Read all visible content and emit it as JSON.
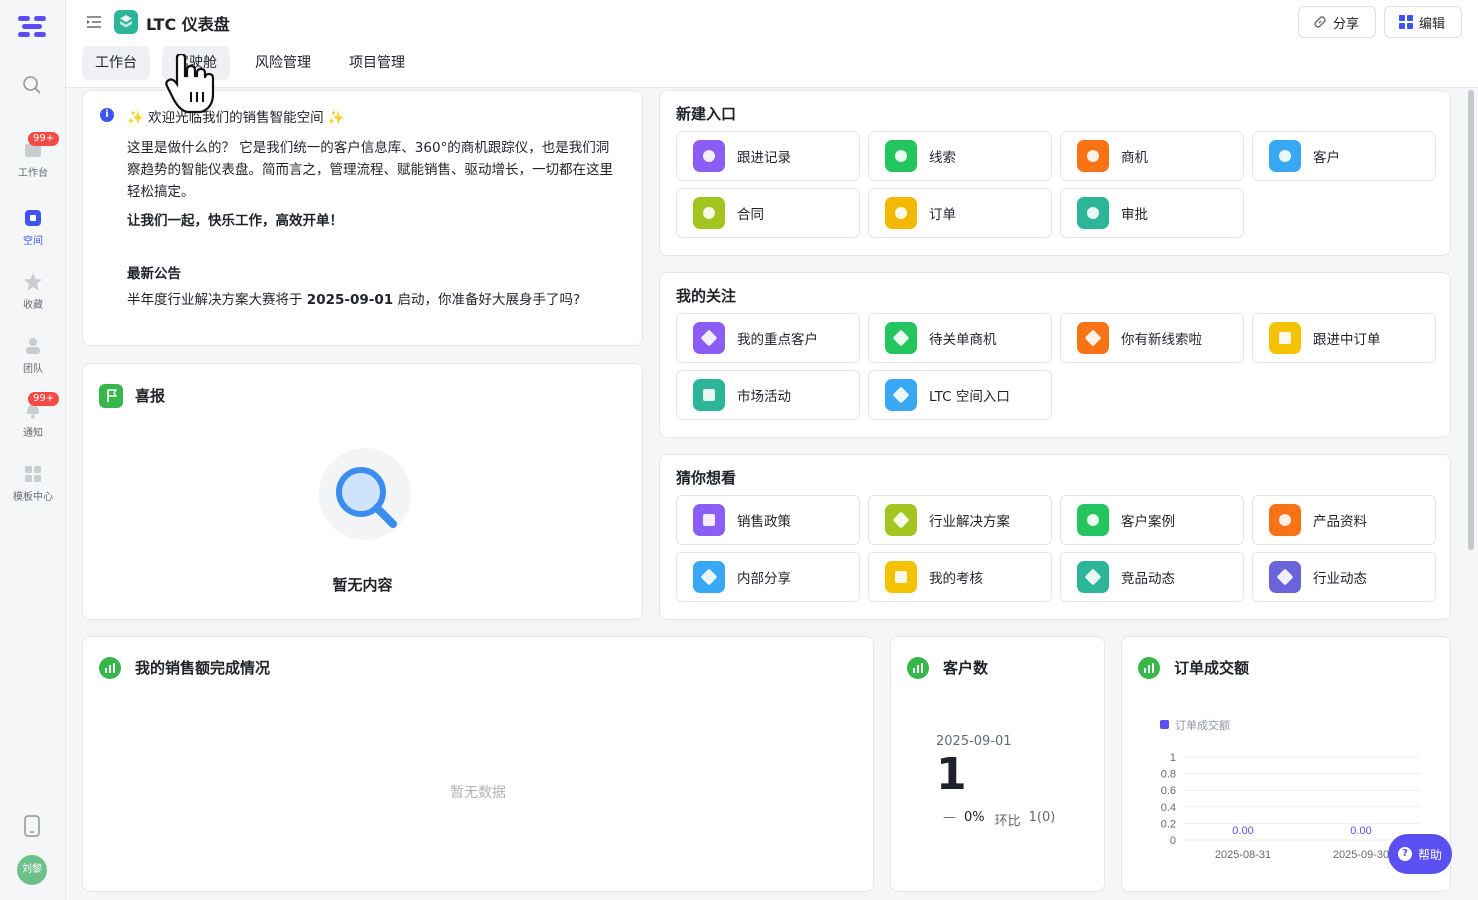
{
  "app": {
    "title": "LTC 仪表盘",
    "share_label": "分享",
    "edit_label": "编辑"
  },
  "tabs": [
    {
      "label": "工作台",
      "active": true
    },
    {
      "label": "驾驶舱",
      "active": false
    },
    {
      "label": "风险管理",
      "active": false
    },
    {
      "label": "项目管理",
      "active": false
    }
  ],
  "sidebar": {
    "items": [
      {
        "label": "工作台",
        "icon": "workspace-icon",
        "badge": "99+"
      },
      {
        "label": "空间",
        "icon": "space-icon",
        "active": true
      },
      {
        "label": "收藏",
        "icon": "star-icon"
      },
      {
        "label": "团队",
        "icon": "team-icon"
      },
      {
        "label": "通知",
        "icon": "bell-icon",
        "badge": "99+"
      },
      {
        "label": "模板中心",
        "icon": "template-icon"
      }
    ],
    "avatar_text": "刘黎"
  },
  "welcome": {
    "heading": "✨ 欢迎光临我们的销售智能空间 ✨",
    "para1": "这里是做什么的？ 它是我们统一的客户信息库、360°的商机跟踪仪，也是我们洞察趋势的智能仪表盘。简而言之，管理流程、赋能销售、驱动增长，一切都在这里轻松搞定。",
    "para2": "让我们一起，快乐工作，高效开单！",
    "notice_title": "最新公告",
    "notice_prefix": "半年度行业解决方案大赛将于 ",
    "notice_date": "2025-09-01",
    "notice_suffix": " 启动，你准备好大展身手了吗?"
  },
  "xibao": {
    "title": "喜报",
    "empty": "暂无内容"
  },
  "new_entry": {
    "title": "新建入口",
    "items": [
      {
        "label": "跟进记录",
        "color": "#8b5cf6"
      },
      {
        "label": "线索",
        "color": "#22c55e"
      },
      {
        "label": "商机",
        "color": "#f97316"
      },
      {
        "label": "客户",
        "color": "#38a8f5"
      },
      {
        "label": "合同",
        "color": "#a3c51f"
      },
      {
        "label": "订单",
        "color": "#f5b800"
      },
      {
        "label": "审批",
        "color": "#2db59a"
      }
    ]
  },
  "follow": {
    "title": "我的关注",
    "items": [
      {
        "label": "我的重点客户",
        "color": "#8b5cf6"
      },
      {
        "label": "待关单商机",
        "color": "#22c55e"
      },
      {
        "label": "你有新线索啦",
        "color": "#f97316"
      },
      {
        "label": "跟进中订单",
        "color": "#f5c200"
      },
      {
        "label": "市场活动",
        "color": "#2db59a"
      },
      {
        "label": "LTC 空间入口",
        "color": "#38a8f5"
      }
    ]
  },
  "guess": {
    "title": "猜你想看",
    "items": [
      {
        "label": "销售政策",
        "color": "#8b5cf6"
      },
      {
        "label": "行业解决方案",
        "color": "#a3c51f"
      },
      {
        "label": "客户案例",
        "color": "#22c55e"
      },
      {
        "label": "产品资料",
        "color": "#f97316"
      },
      {
        "label": "内部分享",
        "color": "#38a8f5"
      },
      {
        "label": "我的考核",
        "color": "#f5c200"
      },
      {
        "label": "竞品动态",
        "color": "#2db59a"
      },
      {
        "label": "行业动态",
        "color": "#6b63d9"
      }
    ]
  },
  "sales_completion": {
    "title": "我的销售额完成情况",
    "empty": "暂无数据"
  },
  "customer_count": {
    "title": "客户数",
    "date": "2025-09-01",
    "value": "1",
    "change_dash": "—",
    "change_pct": "0%",
    "compare_label": "环比",
    "compare_value": "1(0)"
  },
  "order_amount": {
    "title": "订单成交额",
    "legend": "订单成交额",
    "y_ticks": [
      "1",
      "0.8",
      "0.6",
      "0.4",
      "0.2",
      "0"
    ],
    "x_ticks": [
      "2025-08-31",
      "2025-09-30"
    ],
    "point_labels": [
      "0.00",
      "0.00"
    ]
  },
  "chart_data": {
    "type": "bar",
    "title": "订单成交额",
    "categories": [
      "2025-08-31",
      "2025-09-30"
    ],
    "series": [
      {
        "name": "订单成交额",
        "values": [
          0,
          0
        ]
      }
    ],
    "ylim": [
      0,
      1
    ],
    "xlabel": "",
    "ylabel": "",
    "grid": true,
    "legend": "top-left"
  },
  "help_label": "帮助",
  "colors": {
    "accent": "#5a4ff0",
    "brand_green": "#35b849",
    "badge_red": "#f54a45"
  }
}
